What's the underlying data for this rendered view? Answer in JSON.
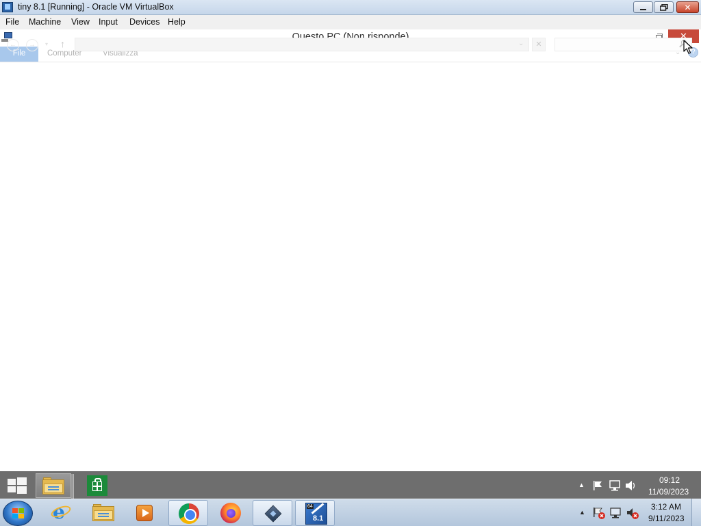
{
  "vbox": {
    "title": "tiny 8.1 [Running] - Oracle VM VirtualBox",
    "menu": [
      "File",
      "Machine",
      "View",
      "Input",
      "Devices",
      "Help"
    ],
    "window_controls": {
      "close": "✕"
    }
  },
  "explorer": {
    "title": "Questo PC (Non risponde)",
    "close_glyph": "✕",
    "ribbon_tabs": [
      "File",
      "Computer",
      "Visualizza"
    ],
    "address_value": "",
    "search_placeholder": "",
    "help_glyph": "?",
    "ribbon_chevron_glyph": "⌄",
    "clear_glyph": "✕",
    "dropdown_glyph": "⌄",
    "up_glyph": "↑",
    "back_glyph": "←",
    "forward_glyph": "→",
    "recent_glyph": "▾"
  },
  "guest_taskbar": {
    "apps": [
      "start-button",
      "file-explorer",
      "store"
    ],
    "tray_glyphs": {
      "expand": "▲"
    },
    "clock_time": "09:12",
    "clock_date": "11/09/2023"
  },
  "host_taskbar": {
    "apps": [
      "start-orb",
      "internet-explorer",
      "windows-explorer",
      "windows-media-player",
      "chrome",
      "firefox",
      "virtualbox",
      "tiny-8.1-vm"
    ],
    "active_apps": [
      "chrome",
      "virtualbox",
      "tiny-8.1-vm"
    ],
    "tray_glyphs": {
      "expand": "▲"
    },
    "clock_time": "3:12 AM",
    "clock_date": "9/11/2023",
    "tiny_vm_badge": "64",
    "tiny_vm_version": "8.1"
  },
  "colors": {
    "close_red": "#c7493a",
    "guest_taskbar": "#6e6e6e",
    "host_taskbar": "#b3c6dc",
    "file_tab": "#a8c8ec"
  }
}
